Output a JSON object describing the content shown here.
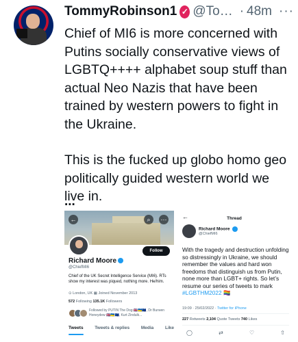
{
  "tweet": {
    "display_name": "TommyRobinson1",
    "verified_glyph": "✓",
    "handle": "@To…",
    "separator": "·",
    "time": "48m",
    "more": "···",
    "paragraphs": [
      "Chief of MI6 is more concerned with Putins socially conservative views of LGBTQ++++ alphabet soup stuff than actual Neo Nazis that have been trained by western powers to fight in the Ukraine.",
      "This is the fucked up globo homo geo politically guided western world we live in."
    ],
    "ellipsis": "..."
  },
  "profile_shot": {
    "follow_label": "Follow",
    "name": "Richard Moore",
    "handle": "@ChiefMI6",
    "bio": "Chief of the UK Secret Intelligence Service (MI6). RTs show my interest was piqued, nothing more. He/him.",
    "location": "London, UK",
    "joined": "Joined November 2013",
    "following_count": "572",
    "following_label": "Following",
    "followers_count": "135.1K",
    "followers_label": "Followers",
    "followed_by": "Followed by PUTIN The Dog 🇬🇧🇺🇦🇪🇺, Dr Burwen Honeydew 🇬🇧🇺🇦🇪🇺, Kurt Zindulk...",
    "tabs": [
      "Tweets",
      "Tweets & replies",
      "Media",
      "Like"
    ]
  },
  "thread_shot": {
    "back": "←",
    "title": "Thread",
    "name": "Richard Moore",
    "handle": "@ChiefMI6",
    "text": "With the tragedy and destruction unfolding so distressingly in Ukraine, we should remember the values and hard won freedoms that distinguish us from Putin, none more than LGBT+ rights. So let’s resume our series of tweets to mark",
    "hashtag": "#LGBTHM2022",
    "time": "19:09 · 25/02/2022 ·",
    "client": "Twitter for iPhone",
    "retweets_count": "227",
    "retweets_label": "Retweets",
    "quotes_count": "2,104",
    "quotes_label": "Quote Tweets",
    "likes_count": "740",
    "likes_label": "Likes",
    "actions": [
      "reply-icon",
      "retweet-icon",
      "like-icon",
      "share-icon"
    ]
  }
}
